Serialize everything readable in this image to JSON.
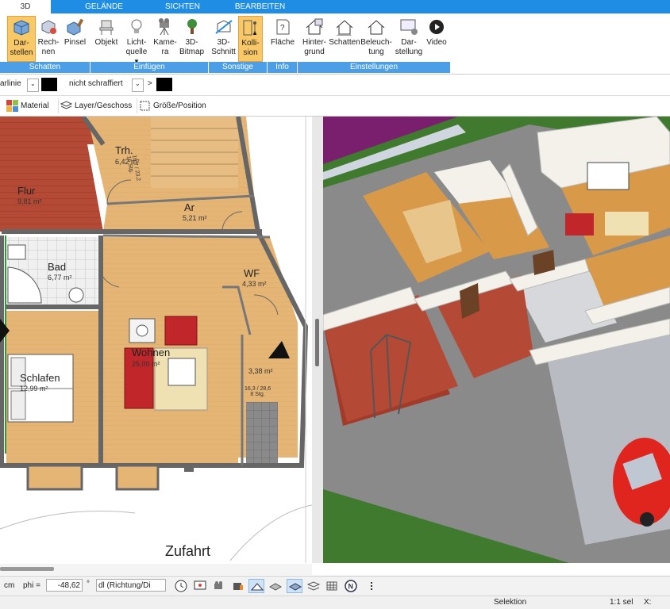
{
  "tabs": [
    {
      "label": "3D",
      "active": true
    },
    {
      "label": "GELÄNDE",
      "active": false
    },
    {
      "label": "SICHTEN",
      "active": false
    },
    {
      "label": "BEARBEITEN",
      "active": false
    }
  ],
  "ribbon": {
    "buttons": {
      "darstellen": "Dar-\nstellen",
      "rechnen": "Rech-\nnen",
      "pinsel": "Pinsel",
      "objekt": "Objekt",
      "lichtquelle": "Licht-\nquelle",
      "kamera": "Kame-\nra",
      "bitmap": "3D-\nBitmap",
      "schnitt": "3D-\nSchnitt",
      "kollision": "Kolli-\nsion",
      "flaeche": "Fläche",
      "hintergrund": "Hinter-\ngrund",
      "schatten": "Schatten",
      "beleuchtung": "Beleuch-\ntung",
      "darstellung": "Dar-\nstellung",
      "video": "Video"
    },
    "groups": {
      "schatten": "Schatten",
      "einfuegen": "Einfügen",
      "sonstige": "Sonstige",
      "info": "Info",
      "einstellungen": "Einstellungen"
    }
  },
  "toolbar1": {
    "line_label": "arlinie",
    "hatch_label": "nicht schraffiert",
    "arrow": ">"
  },
  "toolbar2": {
    "material": "Material",
    "layer": "Layer/Geschoss",
    "groesse": "Größe/Position"
  },
  "plan": {
    "rooms": [
      {
        "name": "Trh.",
        "area": "6,42 m²"
      },
      {
        "name": "Flur",
        "area": "9,81 m²"
      },
      {
        "name": "Ar",
        "area": "5,21 m²"
      },
      {
        "name": "Bad",
        "area": "6,77 m²"
      },
      {
        "name": "WF",
        "area": "4,33 m²"
      },
      {
        "name": "Wohnen",
        "area": "25,00 m²"
      },
      {
        "name": "Schlafen",
        "area": "12,99 m²"
      },
      {
        "name": "",
        "area": "3,38 m²"
      }
    ],
    "stair1_note": "16,7 / 23,2\n16 Stg.",
    "stair2_note": "16,3 / 28,6\n8 Stg.",
    "zufahrt": "Zufahrt"
  },
  "bottombar": {
    "unit": "cm",
    "phi_label": "phi =",
    "phi_value": "-48,62",
    "degree": "°",
    "dl_value": "dl (Richtung/Di"
  },
  "status": {
    "mode": "Selektion",
    "scale": "1:1 sel",
    "x_label": "X:"
  },
  "colors": {
    "tab_blue": "#1e8de3",
    "group_blue": "#4c9fe6",
    "active_button": "#f9c968",
    "floor_wood": "#e5b575",
    "floor_tile": "#b44a35",
    "grass": "#3f7a2e"
  }
}
